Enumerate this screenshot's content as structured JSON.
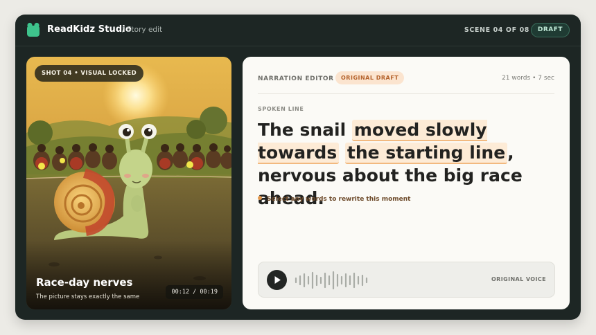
{
  "app": {
    "name": "ReadKidz Studio",
    "breadcrumb": "/ Story edit",
    "scene_counter": "SCENE 04 OF 08",
    "status_badge": "DRAFT",
    "logo_icon": "frog-logo-icon"
  },
  "shot": {
    "badge": "SHOT 04 • VISUAL LOCKED",
    "title": "Race-day nerves",
    "subtitle": "The picture stays exactly the same",
    "timecode": "00:12 / 00:19"
  },
  "editor": {
    "label": "NARRATION EDITOR",
    "badge": "ORIGINAL DRAFT",
    "meta": "21 words • 7 sec",
    "spoken_label": "SPOKEN LINE",
    "line": {
      "before": "The snail ",
      "highlight_1": "moved slowly towards",
      "highlight_2": "the starting line",
      "after": ", nervous about the big race ahead."
    },
    "hint": "Select any words to rewrite this moment"
  },
  "player": {
    "play_icon": "play-icon",
    "voice_label": "ORIGINAL VOICE"
  },
  "colors": {
    "window_bg": "#1d2624",
    "accent_orange": "#e59a4e",
    "highlight": "#fdebd6",
    "draft_badge": "#bfe8d6"
  }
}
